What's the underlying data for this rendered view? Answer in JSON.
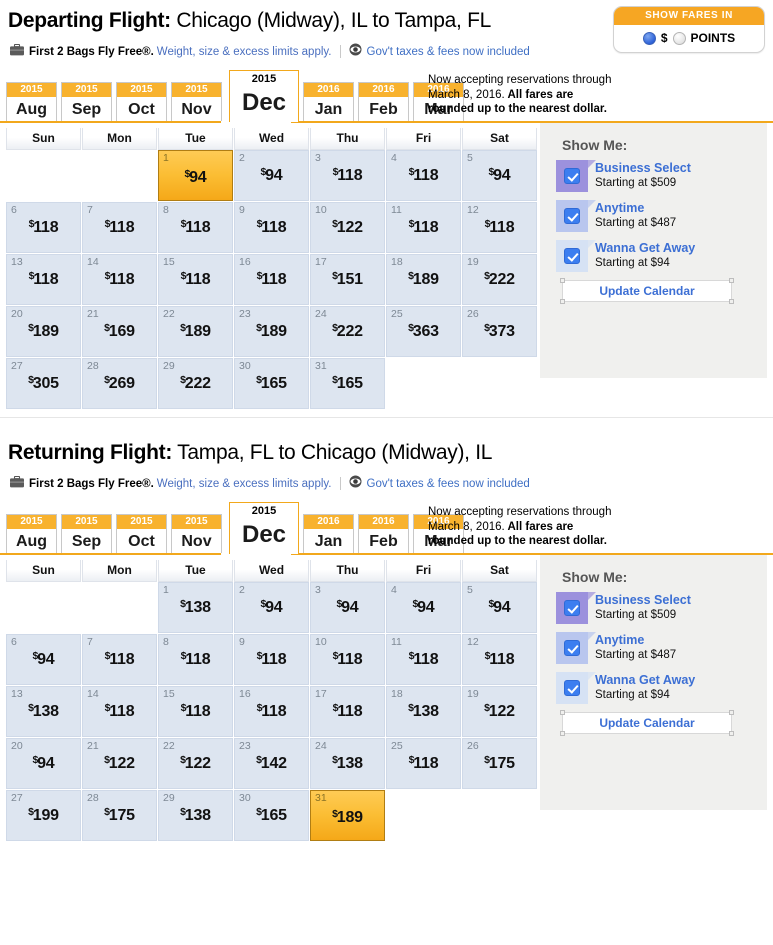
{
  "fares_widget": {
    "header": "SHOW FARES IN",
    "options": [
      {
        "label": "$",
        "selected": true
      },
      {
        "label": "POINTS",
        "selected": false
      }
    ]
  },
  "bags_notice": {
    "bag_icon": "briefcase-icon",
    "strong": "First 2 Bags Fly Free®.",
    "muted": "Weight, size & excess limits apply.",
    "eye_icon": "eye-icon",
    "taxes_link": "Gov't taxes & fees now included"
  },
  "reservation_note": {
    "line1": "Now accepting reservations through",
    "line2": "March 8, 2016.",
    "line2_bold": " All fares are",
    "line3": "rounded up to the nearest dollar."
  },
  "month_tabs": [
    {
      "year": "2015",
      "month": "Aug",
      "active": false
    },
    {
      "year": "2015",
      "month": "Sep",
      "active": false
    },
    {
      "year": "2015",
      "month": "Oct",
      "active": false
    },
    {
      "year": "2015",
      "month": "Nov",
      "active": false
    },
    {
      "year": "2015",
      "month": "Dec",
      "active": true
    },
    {
      "year": "2016",
      "month": "Jan",
      "active": false
    },
    {
      "year": "2016",
      "month": "Feb",
      "active": false
    },
    {
      "year": "2016",
      "month": "Mar",
      "active": false
    }
  ],
  "weekdays": [
    "Sun",
    "Mon",
    "Tue",
    "Wed",
    "Thu",
    "Fri",
    "Sat"
  ],
  "sidebar": {
    "title": "Show Me:",
    "fare_types": [
      {
        "name": "Business Select",
        "sub": "Starting at $509",
        "color": "#9c91dd",
        "checked": true
      },
      {
        "name": "Anytime",
        "sub": "Starting at $487",
        "color": "#b9c6ee",
        "checked": true
      },
      {
        "name": "Wanna Get Away",
        "sub": "Starting at $94",
        "color": "#d6e2f4",
        "checked": true
      }
    ],
    "update_button": "Update Calendar"
  },
  "departing": {
    "title_lead": "Departing Flight:",
    "title_rest": " Chicago (Midway), IL to Tampa, FL",
    "days": [
      {
        "day": "",
        "price": "",
        "empty": true
      },
      {
        "day": "",
        "price": "",
        "empty": true
      },
      {
        "day": "1",
        "price": "94",
        "selected": true
      },
      {
        "day": "2",
        "price": "94"
      },
      {
        "day": "3",
        "price": "118"
      },
      {
        "day": "4",
        "price": "118"
      },
      {
        "day": "5",
        "price": "94"
      },
      {
        "day": "6",
        "price": "118"
      },
      {
        "day": "7",
        "price": "118"
      },
      {
        "day": "8",
        "price": "118"
      },
      {
        "day": "9",
        "price": "118"
      },
      {
        "day": "10",
        "price": "122"
      },
      {
        "day": "11",
        "price": "118"
      },
      {
        "day": "12",
        "price": "118"
      },
      {
        "day": "13",
        "price": "118"
      },
      {
        "day": "14",
        "price": "118"
      },
      {
        "day": "15",
        "price": "118"
      },
      {
        "day": "16",
        "price": "118"
      },
      {
        "day": "17",
        "price": "151"
      },
      {
        "day": "18",
        "price": "189"
      },
      {
        "day": "19",
        "price": "222"
      },
      {
        "day": "20",
        "price": "189"
      },
      {
        "day": "21",
        "price": "169"
      },
      {
        "day": "22",
        "price": "189"
      },
      {
        "day": "23",
        "price": "189"
      },
      {
        "day": "24",
        "price": "222"
      },
      {
        "day": "25",
        "price": "363"
      },
      {
        "day": "26",
        "price": "373"
      },
      {
        "day": "27",
        "price": "305"
      },
      {
        "day": "28",
        "price": "269"
      },
      {
        "day": "29",
        "price": "222"
      },
      {
        "day": "30",
        "price": "165"
      },
      {
        "day": "31",
        "price": "165"
      },
      {
        "day": "",
        "price": "",
        "empty": true
      },
      {
        "day": "",
        "price": "",
        "empty": true
      }
    ]
  },
  "returning": {
    "title_lead": "Returning Flight:",
    "title_rest": " Tampa, FL to Chicago (Midway), IL",
    "days": [
      {
        "day": "",
        "price": "",
        "empty": true
      },
      {
        "day": "",
        "price": "",
        "empty": true
      },
      {
        "day": "1",
        "price": "138"
      },
      {
        "day": "2",
        "price": "94"
      },
      {
        "day": "3",
        "price": "94"
      },
      {
        "day": "4",
        "price": "94"
      },
      {
        "day": "5",
        "price": "94"
      },
      {
        "day": "6",
        "price": "94"
      },
      {
        "day": "7",
        "price": "118"
      },
      {
        "day": "8",
        "price": "118"
      },
      {
        "day": "9",
        "price": "118"
      },
      {
        "day": "10",
        "price": "118"
      },
      {
        "day": "11",
        "price": "118"
      },
      {
        "day": "12",
        "price": "118"
      },
      {
        "day": "13",
        "price": "138"
      },
      {
        "day": "14",
        "price": "118"
      },
      {
        "day": "15",
        "price": "118"
      },
      {
        "day": "16",
        "price": "118"
      },
      {
        "day": "17",
        "price": "118"
      },
      {
        "day": "18",
        "price": "138"
      },
      {
        "day": "19",
        "price": "122"
      },
      {
        "day": "20",
        "price": "94"
      },
      {
        "day": "21",
        "price": "122"
      },
      {
        "day": "22",
        "price": "122"
      },
      {
        "day": "23",
        "price": "142"
      },
      {
        "day": "24",
        "price": "138"
      },
      {
        "day": "25",
        "price": "118"
      },
      {
        "day": "26",
        "price": "175"
      },
      {
        "day": "27",
        "price": "199"
      },
      {
        "day": "28",
        "price": "175"
      },
      {
        "day": "29",
        "price": "138"
      },
      {
        "day": "30",
        "price": "165"
      },
      {
        "day": "31",
        "price": "189",
        "selected": true
      },
      {
        "day": "",
        "price": "",
        "empty": true
      },
      {
        "day": "",
        "price": "",
        "empty": true
      }
    ]
  }
}
